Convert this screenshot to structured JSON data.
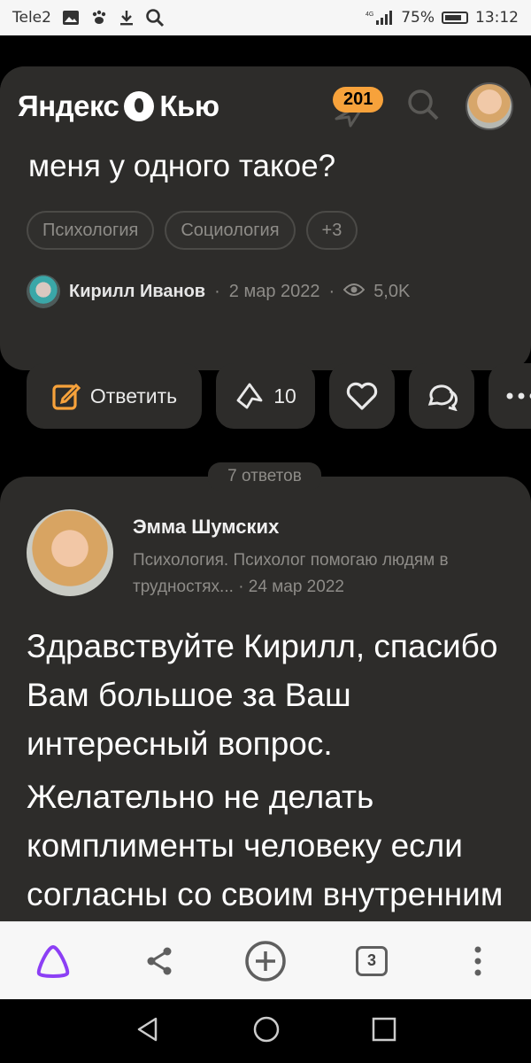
{
  "status_bar": {
    "carrier": "Tele2",
    "network": "4G",
    "battery_percent": "75%",
    "time": "13:12"
  },
  "header": {
    "logo_text_left": "Яндекс",
    "logo_text_right": "Кью",
    "notification_count": "201"
  },
  "question": {
    "title_fragment": "меня у одного такое?",
    "tags": [
      "Психология",
      "Социология",
      "+3"
    ],
    "author": "Кирилл Иванов",
    "date": "2 мар 2022",
    "views": "5,0K"
  },
  "actions": {
    "reply_label": "Ответить",
    "upvote_count": "10"
  },
  "answers": {
    "count_label": "7 ответов",
    "first": {
      "author": "Эмма Шумских",
      "subtitle": "Психология. Психолог помогаю людям в трудностях...",
      "date": "24 мар 2022",
      "paragraph1": "Здравствуйте  Кирилл, спасибо Вам большое за Ваш интересный вопрос.",
      "paragraph2": "Желательно не делать комплименты человеку если согласны со своим внутренним ощущением и"
    }
  },
  "browser_bar": {
    "tab_count": "3"
  },
  "colors": {
    "accent": "#f7a23b",
    "card": "#2d2c2a",
    "alice": "#8c3ff5"
  }
}
